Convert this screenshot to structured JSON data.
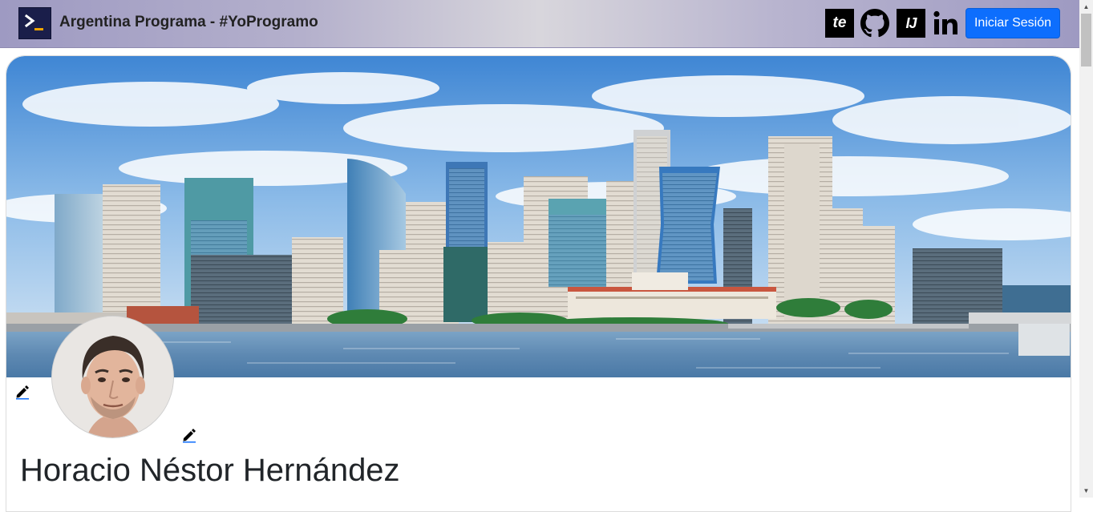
{
  "navbar": {
    "title": "Argentina Programa - #YoProgramo",
    "logo_icon": "terminal-prompt-icon",
    "social_links": [
      {
        "name": "te",
        "label": "te",
        "icon": "te-logo-icon"
      },
      {
        "name": "github",
        "label": "",
        "icon": "github-icon"
      },
      {
        "name": "intellij",
        "label": "IJ",
        "icon": "intellij-icon"
      },
      {
        "name": "linkedin",
        "label": "",
        "icon": "linkedin-icon"
      }
    ],
    "login_label": "Iniciar Sesión"
  },
  "profile": {
    "banner_icon": "city-skyline-banner",
    "avatar_icon": "profile-photo",
    "edit_banner_icon": "pencil-icon",
    "edit_avatar_icon": "pencil-icon",
    "name": "Horacio Néstor Hernández"
  },
  "colors": {
    "primary_button": "#0d6efd",
    "navbar_edge": "#9e9ac2",
    "text": "#212529"
  }
}
